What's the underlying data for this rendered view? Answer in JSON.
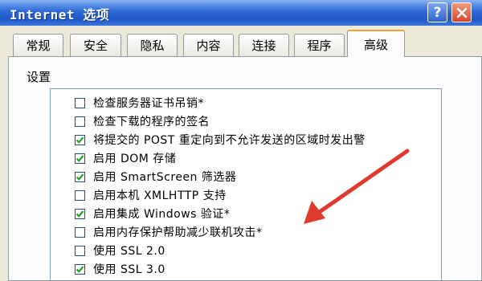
{
  "window": {
    "title": "Internet 选项",
    "help_label": "?"
  },
  "tabs": [
    {
      "label": "常规"
    },
    {
      "label": "安全"
    },
    {
      "label": "隐私"
    },
    {
      "label": "内容"
    },
    {
      "label": "连接"
    },
    {
      "label": "程序"
    },
    {
      "label": "高级",
      "active": true
    }
  ],
  "settings": {
    "group_label": "设置",
    "items": [
      {
        "label": "检查服务器证书吊销*",
        "checked": false
      },
      {
        "label": "检查下载的程序的签名",
        "checked": false
      },
      {
        "label": "将提交的 POST 重定向到不允许发送的区域时发出警",
        "checked": true
      },
      {
        "label": "启用 DOM 存储",
        "checked": true
      },
      {
        "label": "启用 SmartScreen 筛选器",
        "checked": true
      },
      {
        "label": "启用本机 XMLHTTP 支持",
        "checked": false
      },
      {
        "label": "启用集成 Windows 验证*",
        "checked": true
      },
      {
        "label": "启用内存保护帮助减少联机攻击*",
        "checked": false
      },
      {
        "label": "使用 SSL 2.0",
        "checked": false
      },
      {
        "label": "使用 SSL 3.0",
        "checked": true
      }
    ]
  },
  "colors": {
    "annotation_arrow": "#e03a2f",
    "titlebar": "#2257c9",
    "active_tab_accent": "#f1a13b"
  }
}
